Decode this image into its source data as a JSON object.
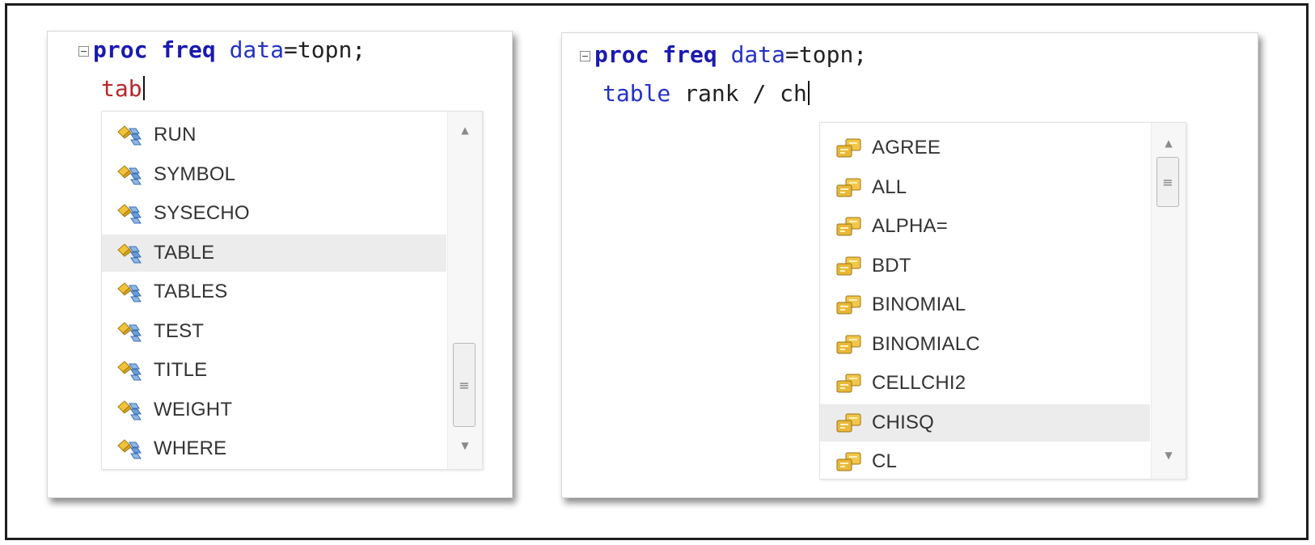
{
  "left_panel": {
    "line1": {
      "keyword": "proc freq",
      "option": "data",
      "rest": "=topn;"
    },
    "line2": {
      "typed": "tab"
    },
    "list_items": [
      {
        "label": "RUN",
        "icon": "statement-icon"
      },
      {
        "label": "SYMBOL",
        "icon": "statement-icon"
      },
      {
        "label": "SYSECHO",
        "icon": "statement-icon"
      },
      {
        "label": "TABLE",
        "icon": "statement-icon",
        "selected": true
      },
      {
        "label": "TABLES",
        "icon": "statement-icon"
      },
      {
        "label": "TEST",
        "icon": "statement-icon"
      },
      {
        "label": "TITLE",
        "icon": "statement-icon"
      },
      {
        "label": "WEIGHT",
        "icon": "statement-icon"
      },
      {
        "label": "WHERE",
        "icon": "statement-icon"
      }
    ],
    "scroll_up": "▲",
    "scroll_down": "▼",
    "thumb_grip": "≡"
  },
  "right_panel": {
    "line1": {
      "keyword": "proc freq",
      "option": "data",
      "rest": "=topn;"
    },
    "line2": {
      "keyword": "table",
      "rest": " rank / ch"
    },
    "list_items": [
      {
        "label": "AGREE",
        "icon": "option-icon"
      },
      {
        "label": "ALL",
        "icon": "option-icon"
      },
      {
        "label": "ALPHA=",
        "icon": "option-icon"
      },
      {
        "label": "BDT",
        "icon": "option-icon"
      },
      {
        "label": "BINOMIAL",
        "icon": "option-icon"
      },
      {
        "label": "BINOMIALC",
        "icon": "option-icon"
      },
      {
        "label": "CELLCHI2",
        "icon": "option-icon"
      },
      {
        "label": "CHISQ",
        "icon": "option-icon",
        "selected": true
      },
      {
        "label": "CL",
        "icon": "option-icon"
      }
    ],
    "scroll_up": "▲",
    "scroll_down": "▼",
    "thumb_grip": "≡"
  },
  "colors": {
    "keyword": "#1a1ab0",
    "typed_red": "#b8282a",
    "selection": "#ececec"
  }
}
